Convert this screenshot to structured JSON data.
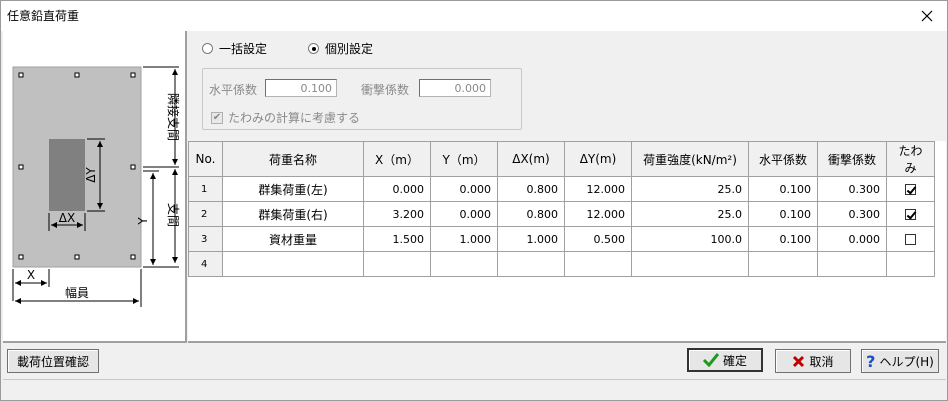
{
  "window": {
    "title": "任意鉛直荷重"
  },
  "diagram": {
    "label_dy": "ΔY",
    "label_dx": "ΔX",
    "label_y": "Y",
    "label_x": "X",
    "label_width": "幅員",
    "label_adjacent_span": "隣接支間",
    "label_span": "支間"
  },
  "options": {
    "radio_batch": "一括設定",
    "radio_individual": "個別設定",
    "selected": "個別設定",
    "horizontal_coef_label": "水平係数",
    "horizontal_coef_value": "0.100",
    "impact_coef_label": "衝撃係数",
    "impact_coef_value": "0.000",
    "deflection_label": "たわみの計算に考慮する",
    "deflection_checked": true
  },
  "grid": {
    "headers": [
      "No.",
      "荷重名称",
      "X（m）",
      "Y（m）",
      "ΔX(m)",
      "ΔY(m)",
      "荷重強度(kN/m²)",
      "水平係数",
      "衝撃係数",
      "たわみ"
    ],
    "rows": [
      {
        "no": "1",
        "name": "群集荷重(左)",
        "x": "0.000",
        "y": "0.000",
        "dx": "0.800",
        "dy": "12.000",
        "strength": "25.0",
        "hcoef": "0.100",
        "icoef": "0.300",
        "deflection": true
      },
      {
        "no": "2",
        "name": "群集荷重(右)",
        "x": "3.200",
        "y": "0.000",
        "dx": "0.800",
        "dy": "12.000",
        "strength": "25.0",
        "hcoef": "0.100",
        "icoef": "0.300",
        "deflection": true
      },
      {
        "no": "3",
        "name": "資材重量",
        "x": "1.500",
        "y": "1.000",
        "dx": "1.000",
        "dy": "0.500",
        "strength": "100.0",
        "hcoef": "0.100",
        "icoef": "0.000",
        "deflection": false
      },
      {
        "no": "4",
        "name": "",
        "x": "",
        "y": "",
        "dx": "",
        "dy": "",
        "strength": "",
        "hcoef": "",
        "icoef": "",
        "deflection": null
      }
    ]
  },
  "buttons": {
    "load_position": "載荷位置確認",
    "confirm": "確定",
    "cancel": "取消",
    "help": "ヘルプ(H)"
  },
  "colors": {
    "confirm_check": "#1e9a1e",
    "cancel_x": "#c00000",
    "help_q": "#1f4fbf",
    "deck": "#c0c0c0",
    "load_area": "#808080"
  }
}
